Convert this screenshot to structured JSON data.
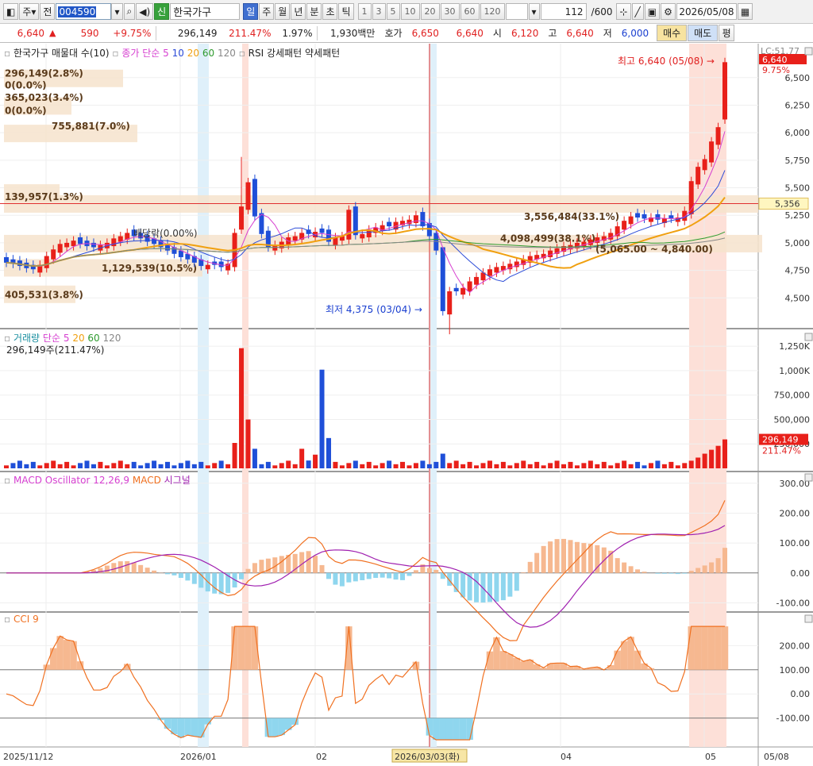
{
  "toolbar": {
    "period_day": "주",
    "prev_label": "전",
    "code": "004590",
    "new_badge": "신",
    "stock_name": "한국가구",
    "periods": [
      "일",
      "주",
      "월",
      "년",
      "분",
      "초",
      "틱"
    ],
    "intervals": [
      "1",
      "3",
      "5",
      "10",
      "20",
      "30",
      "60",
      "120"
    ],
    "count_value": "112",
    "count_total": "/600",
    "date": "2026/05/08"
  },
  "quote": {
    "price": "6,640",
    "change": "590",
    "change_pct": "+9.75%",
    "volume": "296,149",
    "volume_ratio": "211.47%",
    "turnover_pct": "1.97%",
    "amount": "1,930백만",
    "ask_label": "호가",
    "ask1": "6,650",
    "ask2": "6,640",
    "open_label": "시",
    "open": "6,120",
    "high_label": "고",
    "high": "6,640",
    "low_label": "저",
    "low": "6,000",
    "buy_label": "매수",
    "sell_label": "매도",
    "avg_label": "평"
  },
  "price_panel": {
    "legend": [
      "한국가구 매물대 수(10)",
      "종가 단순",
      "5",
      "10",
      "20",
      "60",
      "120",
      "RSI 강세패턴",
      "약세패턴"
    ],
    "high_note": "최고 6,640 (05/08)",
    "low_note": "최저 4,375 (03/04)",
    "dividend_note": "배당락(0.00%)",
    "range_note": "(5,065.00 ~ 4,840.00)",
    "right_price": "6,640",
    "right_pct": "9.75%",
    "hline_price": "5,356",
    "lc_note": "LC:51.77",
    "y_labels": [
      "6,500",
      "6,250",
      "6,000",
      "5,750",
      "5,500",
      "5,250",
      "5,000",
      "4,750",
      "4,500"
    ],
    "profile_labels": [
      "296,149(2.8%)",
      "0(0.0%)",
      "365,023(3.4%)",
      "0(0.0%)",
      "755,881(7.0%)",
      "139,957(1.3%)",
      "3,556,484(33.1%)",
      "4,098,499(38.1%)",
      "1,129,539(10.5%)",
      "405,531(3.8%)"
    ]
  },
  "volume_panel": {
    "legend": [
      "거래량",
      "단순",
      "5",
      "20",
      "60",
      "120"
    ],
    "value": "296,149주(211.47%)",
    "right_value": "296,149",
    "right_pct": "211.47%",
    "y_labels": [
      "1,250K",
      "1,000K",
      "750,000",
      "500,000",
      "250,000"
    ]
  },
  "macd_panel": {
    "legend": [
      "MACD Oscillator 12,26,9",
      "MACD",
      "시그널"
    ],
    "y_labels": [
      "300.00",
      "200.00",
      "100.00",
      "0.00",
      "-100.00"
    ]
  },
  "cci_panel": {
    "legend": [
      "CCI 9"
    ],
    "y_labels": [
      "200.00",
      "100.00",
      "0.00",
      "-100.00"
    ]
  },
  "x_axis": {
    "labels": [
      "2025/11/12",
      "2026/01",
      "02",
      "2026/03/03(화)",
      "04",
      "05",
      "05/08"
    ]
  },
  "colors": {
    "up": "#e8201a",
    "down": "#1f4fd8",
    "ma5": "#d63fd0",
    "ma10": "#2b4bd8",
    "ma20": "#f0a010",
    "ma60": "#2e9a2e",
    "ma120": "#888888",
    "macd": "#f07020",
    "signal": "#a020b0",
    "cci": "#f07020"
  }
}
